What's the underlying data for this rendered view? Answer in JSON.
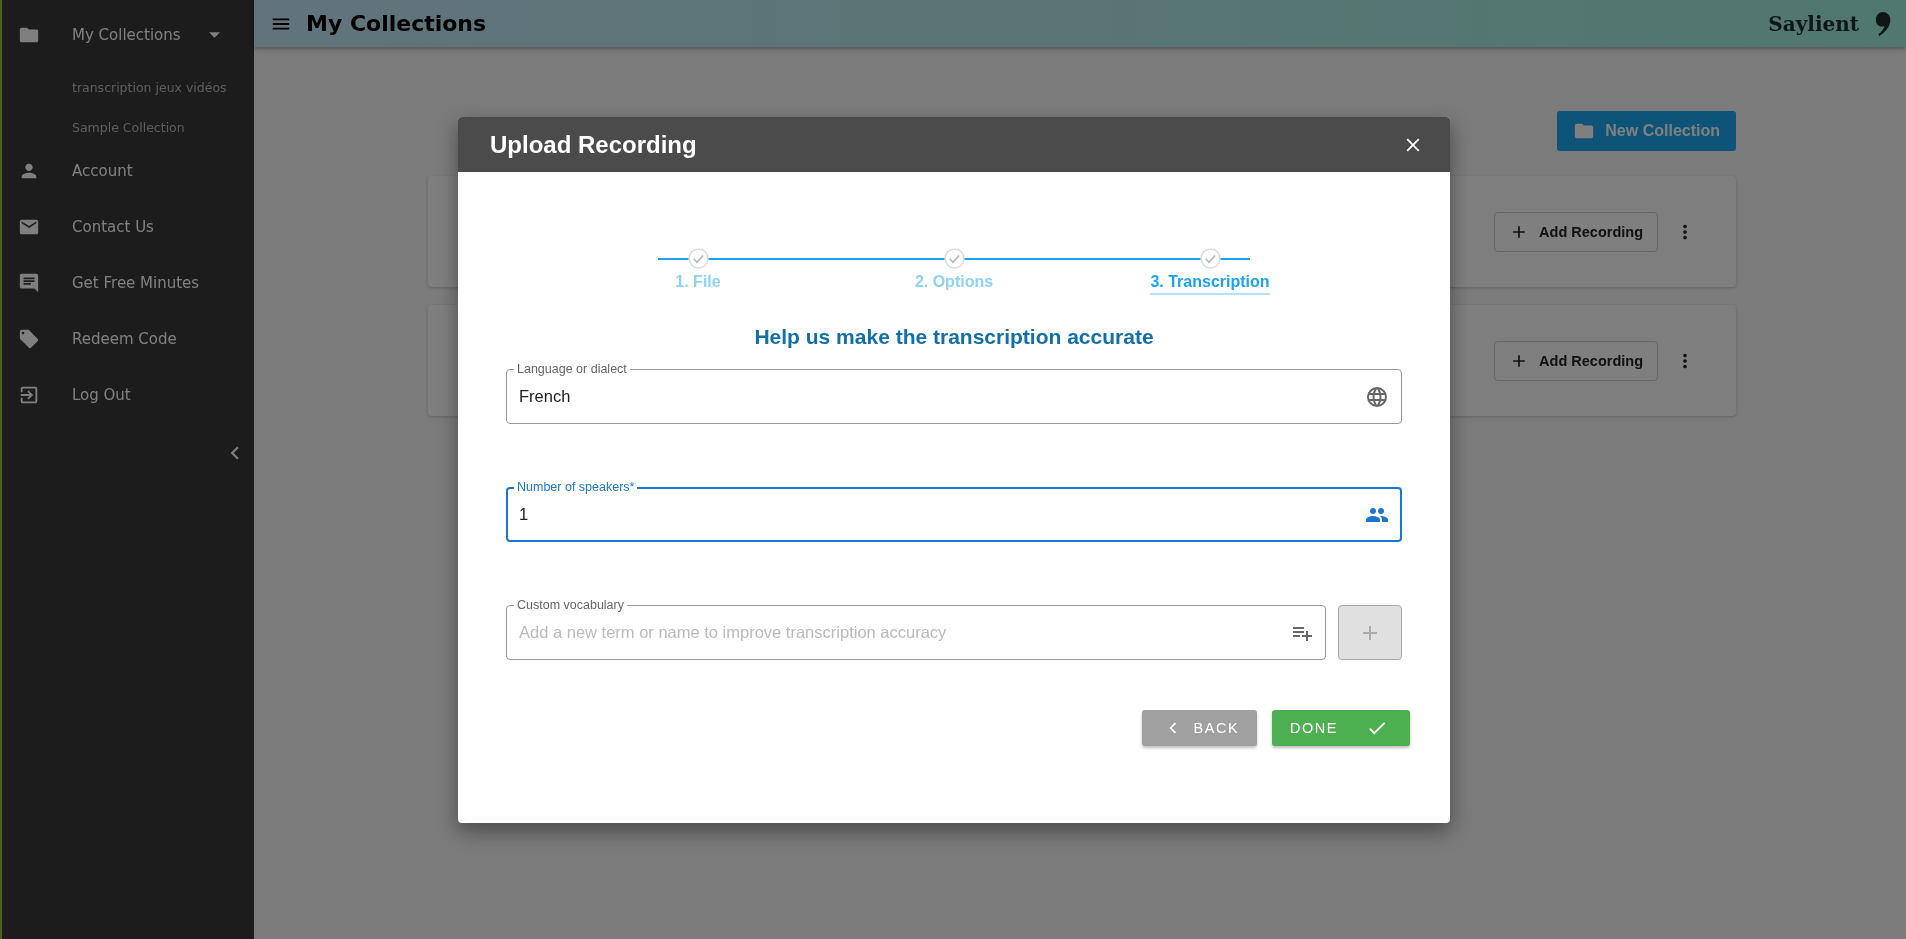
{
  "sidebar": {
    "items": [
      {
        "label": "My Collections",
        "expanded": true,
        "children": [
          {
            "label": "transcription jeux vidéos"
          },
          {
            "label": "Sample Collection"
          }
        ]
      },
      {
        "label": "Account"
      },
      {
        "label": "Contact Us"
      },
      {
        "label": "Get Free Minutes"
      },
      {
        "label": "Redeem Code"
      },
      {
        "label": "Log Out"
      }
    ]
  },
  "header": {
    "title": "My Collections",
    "brand": "Saylient"
  },
  "new_collection_button": "New Collection",
  "collections": [
    {
      "add_button": "Add Recording"
    },
    {
      "add_button": "Add Recording"
    }
  ],
  "dialog": {
    "title": "Upload Recording",
    "steps": [
      {
        "label": "1. File",
        "done": true,
        "selected": false
      },
      {
        "label": "2. Options",
        "done": true,
        "selected": false
      },
      {
        "label": "3. Transcription",
        "done": true,
        "selected": true
      }
    ],
    "heading": "Help us make the transcription accurate",
    "fields": [
      {
        "kind": "language",
        "label": "Language or dialect",
        "value": "French",
        "focused": false
      },
      {
        "kind": "speakers",
        "label": "Number of speakers*",
        "value": "1",
        "focused": true
      },
      {
        "kind": "vocabulary",
        "label": "Custom vocabulary",
        "placeholder": "Add a new term or name to improve transcription accuracy",
        "focused": false,
        "add_disabled": true
      }
    ],
    "back_button": "BACK",
    "done_button": "DONE"
  }
}
